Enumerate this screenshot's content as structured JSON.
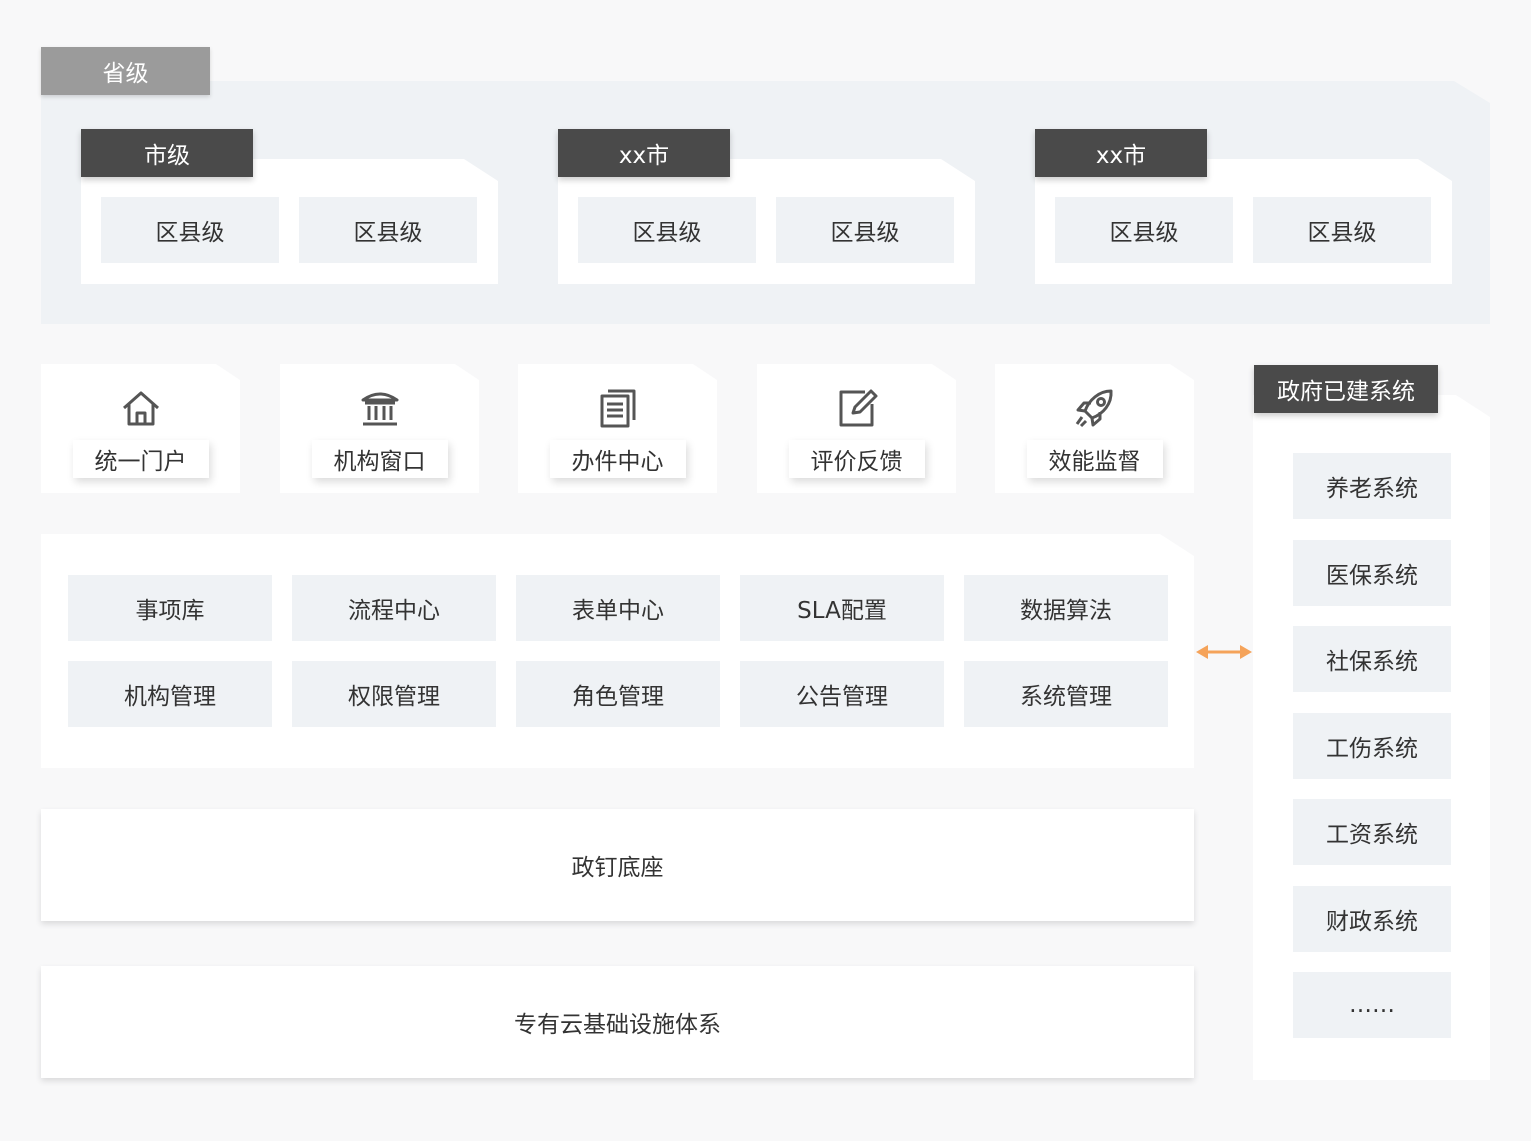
{
  "province": {
    "label": "省级",
    "cities": [
      {
        "label": "市级",
        "counties": [
          "区县级",
          "区县级"
        ]
      },
      {
        "label": "xx市",
        "counties": [
          "区县级",
          "区县级"
        ]
      },
      {
        "label": "xx市",
        "counties": [
          "区县级",
          "区县级"
        ]
      }
    ]
  },
  "portals": [
    {
      "label": "统一门户",
      "icon": "home-icon"
    },
    {
      "label": "机构窗口",
      "icon": "institution-icon"
    },
    {
      "label": "办件中心",
      "icon": "document-icon"
    },
    {
      "label": "评价反馈",
      "icon": "edit-icon"
    },
    {
      "label": "效能监督",
      "icon": "rocket-icon"
    }
  ],
  "modules": [
    [
      "事项库",
      "流程中心",
      "表单中心",
      "SLA配置",
      "数据算法"
    ],
    [
      "机构管理",
      "权限管理",
      "角色管理",
      "公告管理",
      "系统管理"
    ]
  ],
  "base": {
    "platform": "政钉底座",
    "cloud": "专有云基础设施体系"
  },
  "gov": {
    "title": "政府已建系统",
    "items": [
      "养老系统",
      "医保系统",
      "社保系统",
      "工伤系统",
      "工资系统",
      "财政系统",
      "……"
    ]
  },
  "colors": {
    "dark_tab": "#4a4a4a",
    "grey_tab": "#9b9b9b",
    "tile_bg": "#eff2f5",
    "arrow": "#f5a35a"
  }
}
